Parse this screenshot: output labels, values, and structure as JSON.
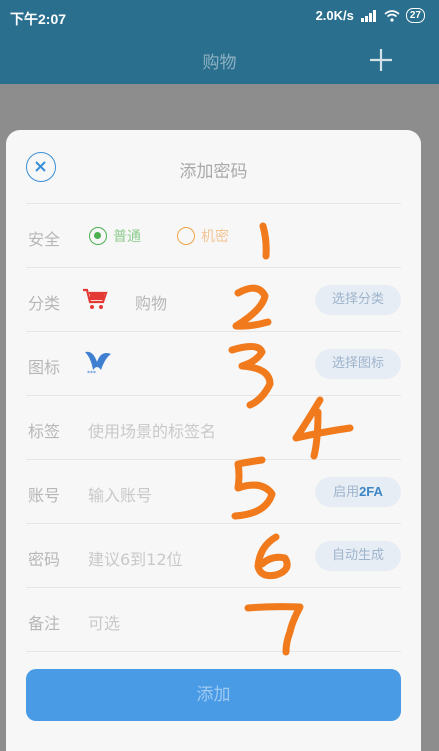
{
  "status": {
    "time": "下午2:07",
    "speed": "2.0K/s",
    "battery": "27"
  },
  "appbar": {
    "title": "购物"
  },
  "sheet": {
    "title": "添加密码",
    "rows": {
      "security": {
        "label": "安全",
        "option_normal": "普通",
        "option_secret": "机密"
      },
      "category": {
        "label": "分类",
        "value": "购物",
        "button": "选择分类"
      },
      "icon": {
        "label": "图标",
        "button": "选择图标"
      },
      "tag": {
        "label": "标签",
        "placeholder": "使用场景的标签名"
      },
      "account": {
        "label": "账号",
        "placeholder": "输入账号",
        "button_prefix": "启用",
        "button_suffix": "2FA"
      },
      "password": {
        "label": "密码",
        "placeholder": "建议6到12位",
        "button": "自动生成"
      },
      "note": {
        "label": "备注",
        "placeholder": "可选"
      }
    },
    "submit": "添加"
  },
  "annotations": [
    "1",
    "2",
    "3",
    "4",
    "5",
    "6",
    "7"
  ],
  "colors": {
    "header": "#2b6f8f",
    "accent": "#4a9be6",
    "normal": "#4caf50",
    "secret": "#f0a34a",
    "annotation": "#f07a1c"
  }
}
